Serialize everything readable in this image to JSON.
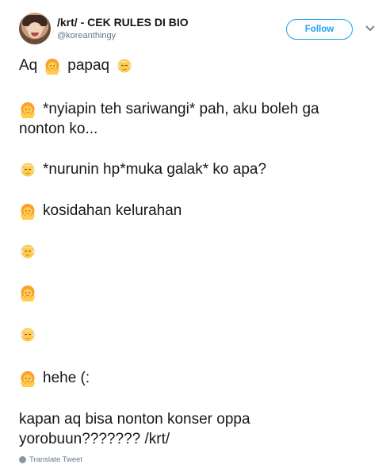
{
  "user": {
    "display_name": "/krt/ - CEK RULES DI BIO",
    "handle": "@koreanthingy"
  },
  "actions": {
    "follow_label": "Follow"
  },
  "icons": {
    "girl": "person-raising-hand-emoji",
    "old": "older-man-emoji",
    "chevron": "chevron-down-icon",
    "globe": "globe-icon"
  },
  "colors": {
    "accent": "#1da1f2",
    "text": "#14171a",
    "muted": "#657786",
    "emoji_yellow": "#ffcc4d",
    "emoji_hair": "#ff9f2e"
  },
  "tweet": {
    "l1_a": "Aq",
    "l1_b": "papaq",
    "l2_a": "*nyiapin teh sariwangi* pah, aku boleh ga",
    "l2_b": "nonton ko...",
    "l3": "*nurunin hp*muka galak* ko apa?",
    "l4": "kosidahan kelurahan",
    "l8": "hehe (:",
    "l9_a": "kapan aq bisa nonton konser oppa",
    "l9_b": "yorobuun??????? /krt/"
  },
  "footer": {
    "translate_label": "Translate Tweet"
  }
}
